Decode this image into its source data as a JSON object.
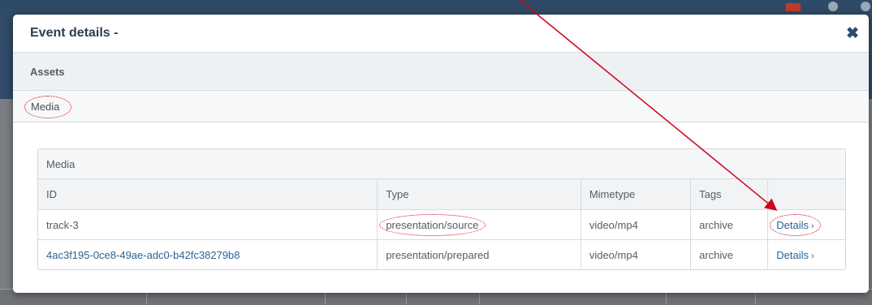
{
  "modal": {
    "title": "Event details -",
    "close_icon": "close-icon"
  },
  "tabs": {
    "primary": "Assets",
    "secondary": "Media"
  },
  "media_panel": {
    "title": "Media",
    "columns": [
      "ID",
      "Type",
      "Mimetype",
      "Tags",
      ""
    ],
    "rows": [
      {
        "id": "track-3",
        "type": "presentation/source",
        "mimetype": "video/mp4",
        "tags": "archive",
        "action": "Details"
      },
      {
        "id": "4ac3f195-0ce8-49ae-adc0-b42fc38279b8",
        "type": "presentation/prepared",
        "mimetype": "video/mp4",
        "tags": "archive",
        "action": "Details"
      }
    ]
  },
  "annotation_color": "#d0021b"
}
